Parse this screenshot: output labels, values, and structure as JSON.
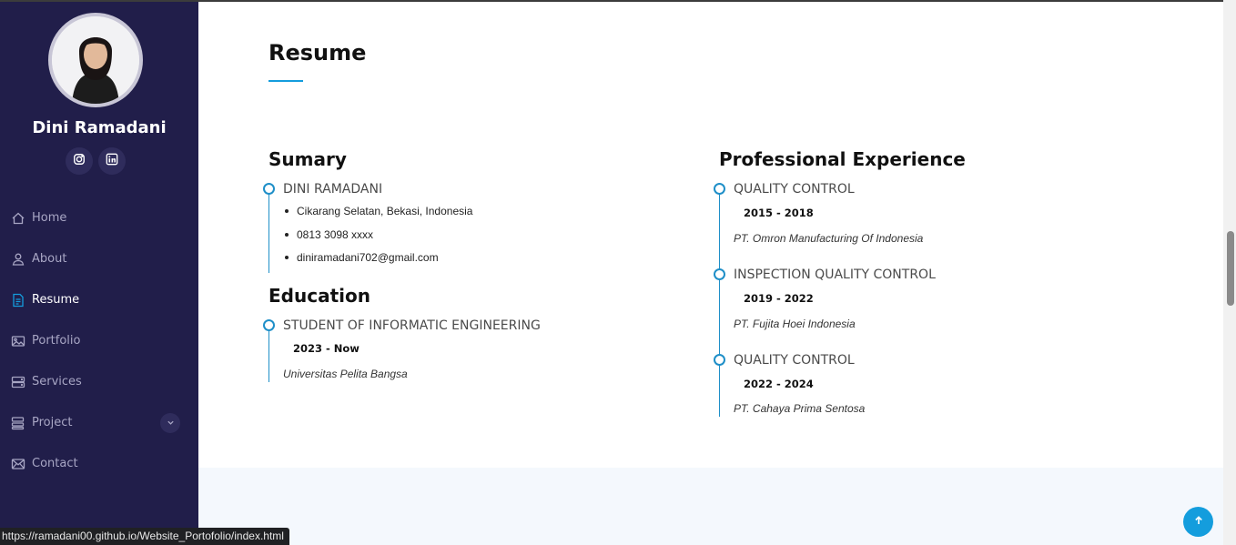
{
  "sidebar": {
    "profile_name": "Dini Ramadani",
    "social": [
      {
        "icon": "instagram-icon"
      },
      {
        "icon": "linkedin-icon"
      }
    ],
    "nav": [
      {
        "label": "Home",
        "icon": "house-icon",
        "active": false
      },
      {
        "label": "About",
        "icon": "person-icon",
        "active": false
      },
      {
        "label": "Resume",
        "icon": "file-text-icon",
        "active": true
      },
      {
        "label": "Portfolio",
        "icon": "images-icon",
        "active": false
      },
      {
        "label": "Services",
        "icon": "hdd-stack-icon",
        "active": false
      },
      {
        "label": "Project",
        "icon": "menu-list-icon",
        "active": false,
        "has_dropdown": true
      },
      {
        "label": "Contact",
        "icon": "envelope-icon",
        "active": false
      }
    ]
  },
  "resume": {
    "title": "Resume",
    "summary": {
      "heading": "Sumary",
      "name": "DINI RAMADANI",
      "details": [
        "Cikarang Selatan, Bekasi, Indonesia",
        "0813 3098 xxxx",
        "diniramadani702@gmail.com"
      ]
    },
    "education": {
      "heading": "Education",
      "items": [
        {
          "title": "STUDENT OF INFORMATIC ENGINEERING",
          "date": "2023 - Now",
          "place": "Universitas Pelita Bangsa"
        }
      ]
    },
    "experience": {
      "heading": "Professional Experience",
      "items": [
        {
          "title": "QUALITY CONTROL",
          "date": "2015 - 2018",
          "place": "PT. Omron Manufacturing Of Indonesia"
        },
        {
          "title": "INSPECTION QUALITY CONTROL",
          "date": "2019 - 2022",
          "place": "PT. Fujita Hoei Indonesia"
        },
        {
          "title": "QUALITY CONTROL",
          "date": "2022 - 2024",
          "place": "PT. Cahaya Prima Sentosa"
        }
      ]
    }
  },
  "status_bar": {
    "url": "https://ramadani00.github.io/Website_Portofolio/index.html"
  },
  "colors": {
    "sidebar_bg": "#211e4a",
    "accent": "#149ddd"
  }
}
